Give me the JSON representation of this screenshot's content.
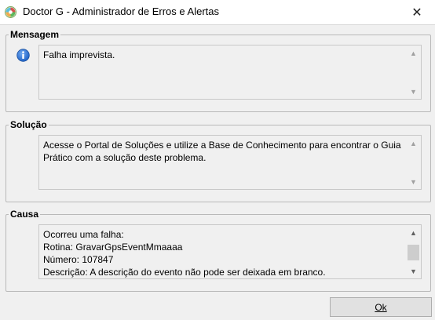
{
  "window": {
    "title": "Doctor G - Administrador de Erros e Alertas",
    "close_glyph": "✕"
  },
  "mensagem": {
    "legend": "Mensagem",
    "icon": "info-icon",
    "text": "Falha imprevista."
  },
  "solucao": {
    "legend": "Solução",
    "text": "Acesse o Portal de Soluções e utilize a Base de Conhecimento para encontrar o Guia Prático com a solução deste problema."
  },
  "causa": {
    "legend": "Causa",
    "lines": [
      "Ocorreu uma falha:",
      "Rotina: GravarGpsEventMmaaaa",
      "Número: 107847",
      "Descrição: A descrição do evento não pode ser deixada em branco."
    ]
  },
  "buttons": {
    "ok_label": "Ok"
  },
  "colors": {
    "info_blue": "#1c5fc4",
    "window_bg": "#f0f0f0"
  }
}
